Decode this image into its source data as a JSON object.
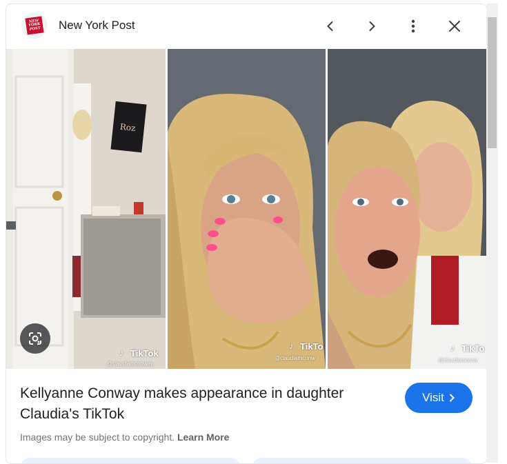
{
  "header": {
    "source_name": "New York Post",
    "logo_text": [
      "NEW",
      "YORK",
      "POST"
    ]
  },
  "images": [
    {
      "tiktok_label": "TikTok",
      "handle": "@claudiamconway"
    },
    {
      "tiktok_label": "TikTo",
      "handle": "@claudiamconw"
    },
    {
      "tiktok_label": "TikTo",
      "handle": "@claudiamconv"
    }
  ],
  "result": {
    "title": "Kellyanne Conway makes appearance in daughter Claudia's TikTok",
    "visit_label": "Visit",
    "copyright_text": "Images may be subject to copyright.",
    "learn_more_label": "Learn More"
  },
  "colors": {
    "accent": "#1a73e8",
    "logo_red": "#c8102e"
  }
}
